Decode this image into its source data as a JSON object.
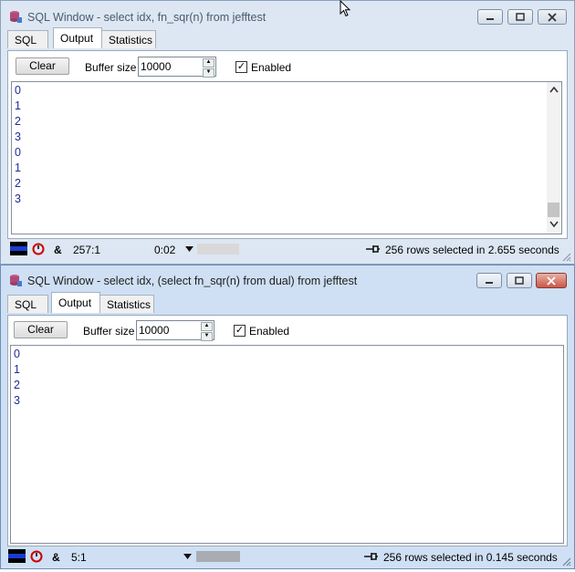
{
  "windows": [
    {
      "title": "SQL Window - select idx, fn_sqr(n) from jefftest",
      "tabs": [
        {
          "label": "SQL"
        },
        {
          "label": "Output",
          "active": true
        },
        {
          "label": "Statistics"
        }
      ],
      "toolbar": {
        "clear_label": "Clear",
        "buffer_label": "Buffer size",
        "buffer_value": "10000",
        "enabled_label": "Enabled",
        "enabled_checked": true
      },
      "output_lines": [
        "0",
        "1",
        "2",
        "3",
        "0",
        "1",
        "2",
        "3"
      ],
      "status": {
        "position": "257:1",
        "elapsed": "0:02",
        "message": "256 rows selected in 2.655 seconds"
      },
      "active": false
    },
    {
      "title": "SQL Window - select idx, (select fn_sqr(n) from dual) from jefftest",
      "tabs": [
        {
          "label": "SQL"
        },
        {
          "label": "Output",
          "active": true
        },
        {
          "label": "Statistics"
        }
      ],
      "toolbar": {
        "clear_label": "Clear",
        "buffer_label": "Buffer size",
        "buffer_value": "10000",
        "enabled_label": "Enabled",
        "enabled_checked": true
      },
      "output_lines": [
        "0",
        "1",
        "2",
        "3"
      ],
      "status": {
        "position": "5:1",
        "elapsed": "",
        "message": "256 rows selected in 0.145 seconds"
      },
      "active": true
    }
  ],
  "status_symbols": {
    "ampersand": "&",
    "check": "✓"
  },
  "colors": {
    "output_text": "#1a2c9c",
    "close_active": "#c9594a"
  }
}
